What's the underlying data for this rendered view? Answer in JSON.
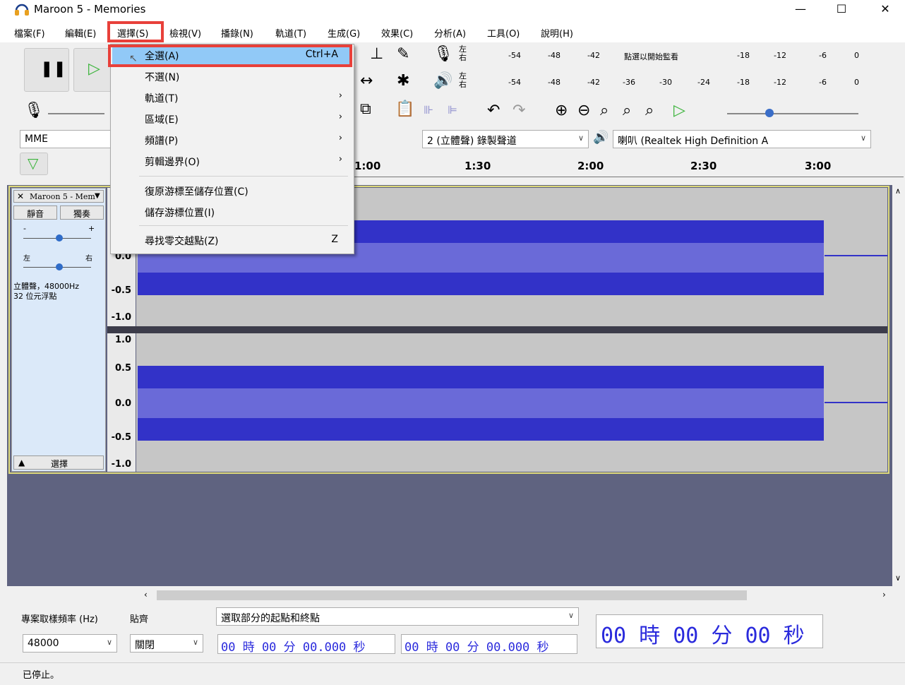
{
  "window": {
    "title": "Maroon 5 - Memories",
    "minimize": "—",
    "maximize": "☐",
    "close": "✕",
    "accent": "#e8403a"
  },
  "menubar": [
    {
      "label": "檔案(F)"
    },
    {
      "label": "編輯(E)"
    },
    {
      "label": "選擇(S)"
    },
    {
      "label": "檢視(V)"
    },
    {
      "label": "播錄(N)"
    },
    {
      "label": "軌道(T)"
    },
    {
      "label": "生成(G)"
    },
    {
      "label": "效果(C)"
    },
    {
      "label": "分析(A)"
    },
    {
      "label": "工具(O)"
    },
    {
      "label": "說明(H)"
    }
  ],
  "dropdown": {
    "items": [
      {
        "label": "全選(A)",
        "shortcut": "Ctrl+A"
      },
      {
        "label": "不選(N)"
      },
      {
        "label": "軌道(T)",
        "submenu": "›"
      },
      {
        "label": "區域(E)",
        "submenu": "›"
      },
      {
        "label": "頻譜(P)",
        "submenu": "›"
      },
      {
        "label": "剪輯邊界(O)",
        "submenu": "›"
      },
      {
        "label": "復原游標至儲存位置(C)"
      },
      {
        "label": "儲存游標位置(I)"
      },
      {
        "label": "尋找零交越點(Z)",
        "shortcut": "Z"
      }
    ]
  },
  "toolbar": {
    "host": "MME",
    "channels": "2 (立體聲) 錄製聲道",
    "output_device": "喇叭 (Realtek High Definition A",
    "meter_rec_hint": "點選以開始監看",
    "meter_ticks_top": [
      "-54",
      "-48",
      "-42",
      "-18",
      "-12",
      "-6",
      "0"
    ],
    "meter_ticks_bottom": [
      "-54",
      "-48",
      "-42",
      "-36",
      "-30",
      "-24",
      "-18",
      "-12",
      "-6",
      "0"
    ],
    "lr_top": "左\n右",
    "lr_bottom": "左\n右"
  },
  "ruler": {
    "labels": [
      "1:00",
      "1:30",
      "2:00",
      "2:30",
      "3:00"
    ]
  },
  "track": {
    "name": "Maroon 5 - Mem",
    "mute": "靜音",
    "solo": "獨奏",
    "gain_minus": "-",
    "gain_plus": "+",
    "pan_left": "左",
    "pan_right": "右",
    "info_line1": "立體聲，48000Hz",
    "info_line2": "32 位元浮點",
    "select": "選擇",
    "scale_top": [
      "0.0",
      "-0.5",
      "-1.0"
    ],
    "scale_bottom": [
      "1.0",
      "0.5",
      "0.0",
      "-0.5",
      "-1.0"
    ],
    "wave_color": "#3232c8",
    "wave_light": "#6a6ad8"
  },
  "bottom": {
    "rate_label": "專案取樣頻率 (Hz)",
    "snap_label": "貼齊",
    "rate_value": "48000",
    "snap_value": "關閉",
    "selection_mode": "選取部分的起點和終點",
    "sel_start": "00 時 00 分 00.000 秒",
    "sel_end": "00 時 00 分 00.000 秒",
    "position": "00 時 00 分 00 秒"
  },
  "status": {
    "text": "已停止。"
  }
}
